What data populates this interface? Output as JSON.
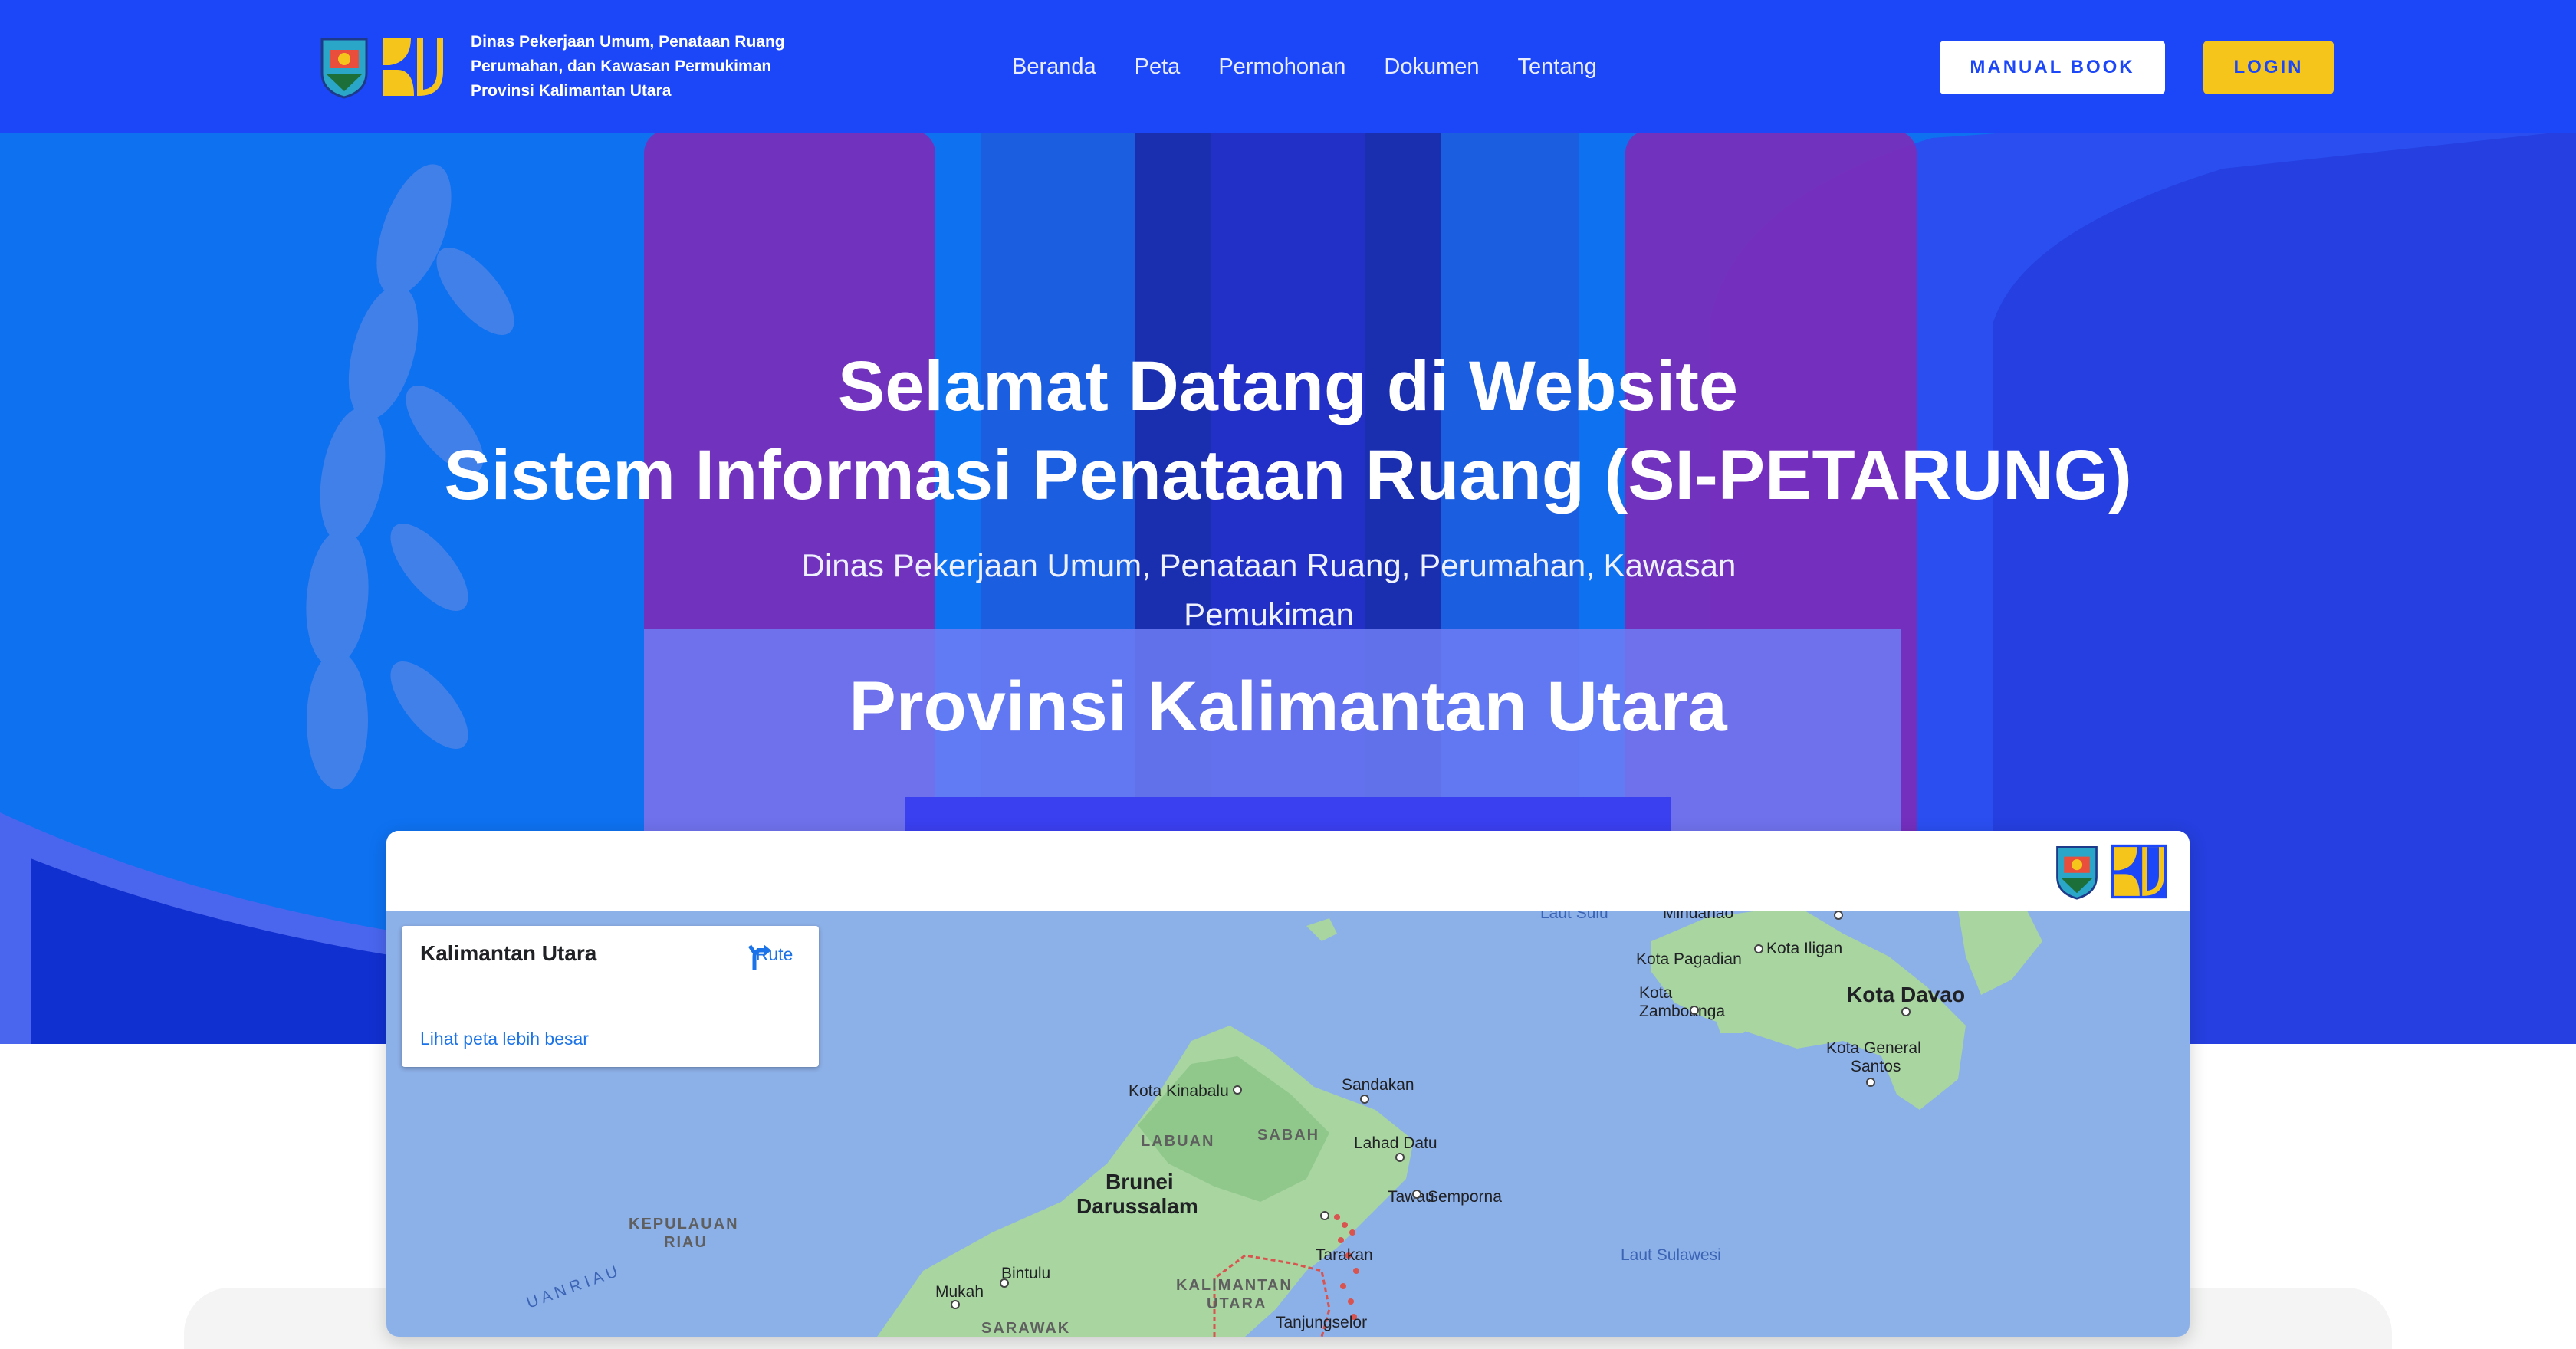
{
  "navbar": {
    "brand_lines": [
      "Dinas Pekerjaan Umum, Penataan Ruang",
      "Perumahan, dan Kawasan Permukiman",
      "Provinsi Kalimantan Utara"
    ],
    "links": [
      "Beranda",
      "Peta",
      "Permohonan",
      "Dokumen",
      "Tentang"
    ],
    "manual_book_label": "MANUAL BOOK",
    "login_label": "LOGIN"
  },
  "hero": {
    "title_line1": "Selamat Datang di Website",
    "title_line2": "Sistem Informasi Penataan Ruang (SI-PETARUNG)",
    "subtitle": "Dinas Pekerjaan Umum, Penataan Ruang, Perumahan, Kawasan Pemukiman",
    "province": "Provinsi Kalimantan Utara"
  },
  "map": {
    "info_title": "Kalimantan Utara",
    "route_label": "Rute",
    "larger_map_link": "Lihat peta lebih besar",
    "labels": {
      "laut_sulu": "Laut Sulu",
      "mindanao": "Mindanao",
      "kota_pagadian": "Kota Pagadian",
      "kota_iligan": "Kota Iligan",
      "kota_zamboanga_1": "Kota",
      "kota_zamboanga_2": "Zamboanga",
      "kota_davao": "Kota Davao",
      "kota_general_santos_1": "Kota General",
      "kota_general_santos_2": "Santos",
      "kota_kinabalu": "Kota Kinabalu",
      "sandakan": "Sandakan",
      "labuan": "LABUAN",
      "sabah": "SABAH",
      "lahad_datu": "Lahad Datu",
      "brunei_1": "Brunei",
      "brunei_2": "Darussalam",
      "tawau": "Tawau",
      "semporna": "Semporna",
      "kepulauan_riau_1": "KEPULAUAN",
      "kepulauan_riau_2": "RIAU",
      "laut_sulawesi": "Laut Sulawesi",
      "bintulu": "Bintulu",
      "tarakan": "Tarakan",
      "kalimantan_utara_1": "KALIMANTAN",
      "kalimantan_utara_2": "UTARA",
      "mukah": "Mukah",
      "sarawak": "SARAWAK",
      "tanjungselor": "Tanjungselor",
      "pulauan_riau": "U A N   R I A U"
    }
  }
}
